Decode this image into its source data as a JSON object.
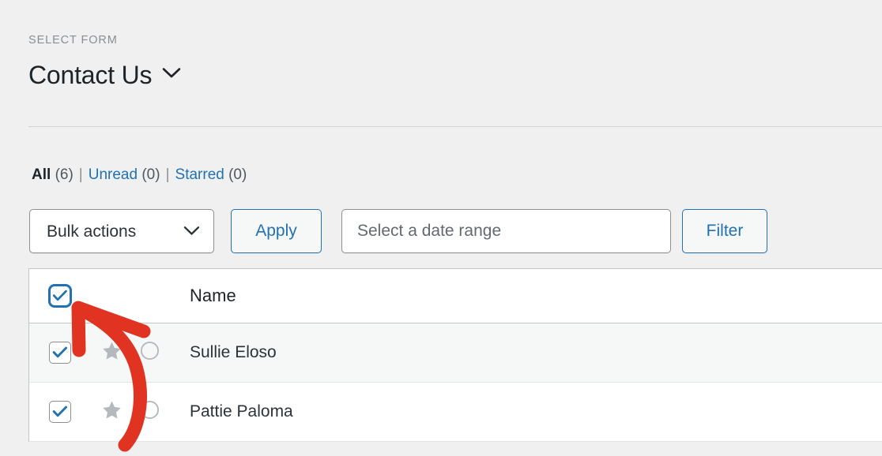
{
  "form_selector": {
    "label": "SELECT FORM",
    "selected_form": "Contact Us",
    "chevron_icon": "chevron-down-icon"
  },
  "filter_links": {
    "all_label": "All",
    "all_count": "(6)",
    "separator": "|",
    "unread_label": "Unread",
    "unread_count": "(0)",
    "starred_label": "Starred",
    "starred_count": "(0)",
    "link_color": "#2271b1"
  },
  "toolbar": {
    "bulk_actions_label": "Bulk actions",
    "bulk_actions_chevron": "chevron-down-icon",
    "apply_label": "Apply",
    "date_range_value": "",
    "date_range_placeholder": "Select a date range",
    "filter_label": "Filter"
  },
  "table": {
    "select_all_checkbox": {
      "name": "select-all-checkbox",
      "checked": true,
      "focused": true
    },
    "columns": {
      "name": "Name"
    },
    "rows": [
      {
        "checked": true,
        "star": "star-icon",
        "starred": false,
        "unread_marker": "circle-icon",
        "name": "Sullie Eloso"
      },
      {
        "checked": true,
        "star": "star-icon",
        "starred": false,
        "unread_marker": "circle-icon",
        "name": "Pattie Paloma"
      }
    ]
  },
  "annotation": {
    "shape": "curved-arrow",
    "color": "#e03321",
    "points_at": "select-all-checkbox"
  }
}
